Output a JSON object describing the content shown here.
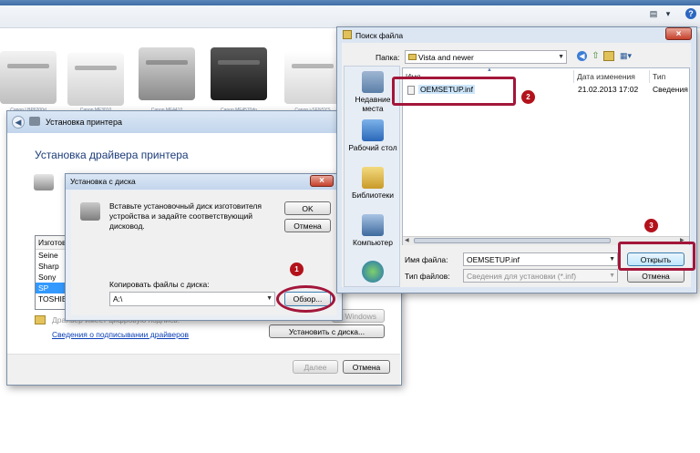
{
  "background_printers": {
    "labels": [
      "Canon LBP6200d",
      "Canon MF3010",
      "Canon MF4410",
      "Canon MF4570dn",
      "Canon i-SENSYS LBP7010C"
    ]
  },
  "install_printer": {
    "title": "Установка принтера",
    "heading": "Установка драйвера принтера",
    "manufacturer_header": "Изготов",
    "manufacturers": [
      "Seine",
      "Sharp",
      "Sony",
      "SP",
      "TOSHIBA"
    ],
    "selected_manufacturer": "SP",
    "signed_text": "Драйвер имеет цифровую подпись.",
    "signing_link": "Сведения о подписывании драйверов",
    "windows_update_button": "Windows",
    "have_disk_button": "Установить с диска...",
    "next_button": "Далее",
    "cancel_button": "Отмена"
  },
  "install_from_disk": {
    "title": "Установка с диска",
    "close_label": "×",
    "message": "Вставьте установочный диск изготовителя устройства и задайте соответствующий дисковод.",
    "ok_button": "OK",
    "cancel_button": "Отмена",
    "copy_label": "Копировать файлы с диска:",
    "path_value": "A:\\",
    "browse_button": "Обзор..."
  },
  "file_search": {
    "title": "Поиск файла",
    "close_label": "×",
    "folder_label": "Папка:",
    "folder_value": "Vista and newer",
    "places": [
      {
        "label": "Недавние места",
        "icon": "recent-places-icon"
      },
      {
        "label": "Рабочий стол",
        "icon": "desktop-icon"
      },
      {
        "label": "Библиотеки",
        "icon": "libraries-icon"
      },
      {
        "label": "Компьютер",
        "icon": "computer-icon"
      },
      {
        "label": "",
        "icon": "network-icon"
      }
    ],
    "columns": [
      "Имя",
      "Дата изменения",
      "Тип"
    ],
    "files": [
      {
        "name": "OEMSETUP.inf",
        "date": "21.02.2013 17:02",
        "type": "Сведения"
      }
    ],
    "filename_label": "Имя файла:",
    "filename_value": "OEMSETUP.inf",
    "filetype_label": "Тип файлов:",
    "filetype_value": "Сведения для установки (*.inf)",
    "open_button": "Открыть",
    "cancel_button": "Отмена"
  },
  "callouts": [
    "1",
    "2",
    "3"
  ],
  "colors": {
    "highlight_ring": "#a3163a",
    "callout_badge": "#b3121b",
    "selection": "#3399ff",
    "link": "#0a3fb5"
  }
}
